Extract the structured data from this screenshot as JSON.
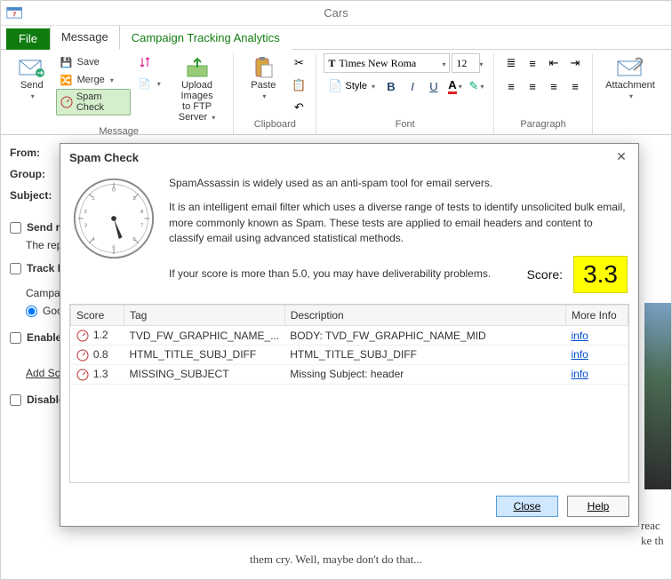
{
  "window": {
    "title": "Cars"
  },
  "menu": {
    "file": "File",
    "tabs": [
      {
        "label": "Message",
        "active": true
      },
      {
        "label": "Campaign Tracking Analytics",
        "active": false
      }
    ]
  },
  "ribbon": {
    "send": "Send",
    "save": "Save",
    "merge": "Merge",
    "spam_check": "Spam Check",
    "upload": "Upload Images\nto FTP Server",
    "paste": "Paste",
    "style": "Style",
    "attachment": "Attachment",
    "font_name": "Times New Roma",
    "font_size": "12",
    "groups": {
      "message": "Message",
      "clipboard": "Clipboard",
      "font": "Font",
      "paragraph": "Paragraph"
    }
  },
  "form": {
    "from": "From:",
    "group": "Group:",
    "subject": "Subject:",
    "send_re": "Send re",
    "rep_text": "The rep",
    "track": "Track R",
    "campa": "Campa",
    "goo": "Goo",
    "enable": "Enable",
    "add_sc": "Add Sc",
    "disable": "Disable"
  },
  "body_tail": "them cry. Well, maybe don't do that...",
  "right_tail_1": "reac",
  "right_tail_2": "ke th",
  "dialog": {
    "title": "Spam Check",
    "intro": "SpamAssassin is widely used as an anti-spam tool for email servers.",
    "desc": "It is an intelligent email filter which uses a diverse range of tests to identify unsolicited bulk email, more commonly known as Spam. These tests are applied to email headers and content to classify email using advanced statistical methods.",
    "warn": "If your score is more than 5.0, you may have deliverability problems.",
    "score_label": "Score:",
    "score": "3.3",
    "columns": [
      "Score",
      "Tag",
      "Description",
      "More Info"
    ],
    "rows": [
      {
        "score": "1.2",
        "tag": "TVD_FW_GRAPHIC_NAME_...",
        "desc": "BODY: TVD_FW_GRAPHIC_NAME_MID",
        "info": "info"
      },
      {
        "score": "0.8",
        "tag": "HTML_TITLE_SUBJ_DIFF",
        "desc": "HTML_TITLE_SUBJ_DIFF",
        "info": "info"
      },
      {
        "score": "1.3",
        "tag": "MISSING_SUBJECT",
        "desc": "Missing Subject: header",
        "info": "info"
      }
    ],
    "close": "Close",
    "help": "Help"
  }
}
